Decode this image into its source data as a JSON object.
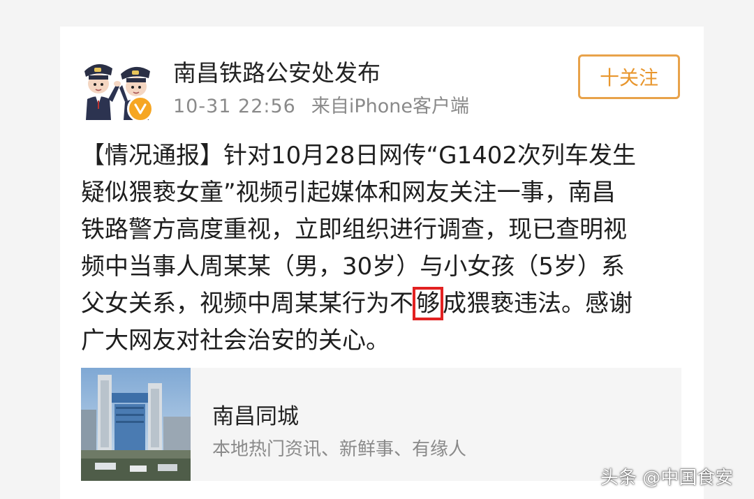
{
  "post": {
    "account_name": "南昌铁路公安处发布",
    "time": "10-31 22:56",
    "source": "来自iPhone客户端",
    "follow_label": "十关注",
    "lines": {
      "l1": "【情况通报】针对10月28日网传“G1402次列车发生",
      "l2": "疑似猥亵女童”视频引起媒体和网友关注一事，南昌",
      "l3": "铁路警方高度重视，立即组织进行调查，现已查明视",
      "l4": "频中当事人周某某（男，30岁）与小女孩（5岁）系",
      "l5_before": "父女关系，视频中周某某行为不",
      "l5_highlight": "够",
      "l5_after": "成猥亵违法。感谢",
      "l6": "广大网友对社会治安的关心。"
    }
  },
  "link_card": {
    "title": "南昌同城",
    "subtitle": "本地热门资讯、新鲜事、有缘人"
  },
  "watermark": "头条 @中国食安",
  "colors": {
    "follow_accent": "#e8962d",
    "verified_badge": "#f6a623",
    "highlight_box": "#e22121"
  },
  "icons": {
    "avatar": "police-officers-avatar",
    "verified": "verified-badge-icon",
    "thumbnail": "railway-station-photo"
  }
}
